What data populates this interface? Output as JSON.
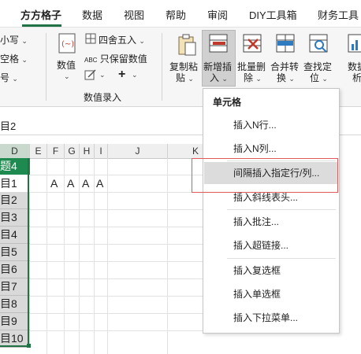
{
  "tabs": [
    {
      "label": "方方格子",
      "active": true
    },
    {
      "label": "数据"
    },
    {
      "label": "视图"
    },
    {
      "label": "帮助"
    },
    {
      "label": "审阅"
    },
    {
      "label": "DIY工具箱"
    },
    {
      "label": "财务工具"
    }
  ],
  "ribbon": {
    "left_items": [
      "小写",
      "空格",
      "号"
    ],
    "number_values": "数值",
    "rounding": "四舍五入",
    "keep_values": "只保留数值",
    "keep_values_prefix": "ABC",
    "group_label": "数值录入",
    "copy_paste": "复制粘贴",
    "copy_paste_l1": "复制粘",
    "copy_paste_l2": "贴",
    "insert_new": "新增插入",
    "insert_new_l1": "新增插",
    "insert_new_l2": "入",
    "batch_delete_l1": "批量删",
    "batch_delete_l2": "除",
    "merge_convert_l1": "合并转",
    "merge_convert_l2": "换",
    "find_locate_l1": "查找定",
    "find_locate_l2": "位",
    "data_analysis_l1": "数据",
    "data_analysis_l2": "析"
  },
  "formula_bar": {
    "value": "目2"
  },
  "columns": [
    "D",
    "E",
    "F",
    "G",
    "H",
    "I",
    "J",
    "K"
  ],
  "header_cell": "题4",
  "row_labels": [
    "目1",
    "目2",
    "目3",
    "目4",
    "目5",
    "目6",
    "目7",
    "目8",
    "目9",
    "目10"
  ],
  "row1_values": [
    "A",
    "A",
    "A",
    "A"
  ],
  "menu": {
    "title": "单元格",
    "items": [
      {
        "label": "插入N行..."
      },
      {
        "label": "插入N列..."
      },
      {
        "label": "间隔插入指定行/列...",
        "highlighted": true
      },
      {
        "label": "插入斜线表头..."
      },
      {
        "label": "插入批注..."
      },
      {
        "label": "插入超链接..."
      },
      {
        "label": "插入复选框"
      },
      {
        "label": "插入单选框"
      },
      {
        "label": "插入下拉菜单..."
      }
    ]
  },
  "colors": {
    "accent": "#217346",
    "highlight_border": "#e05a5a"
  }
}
